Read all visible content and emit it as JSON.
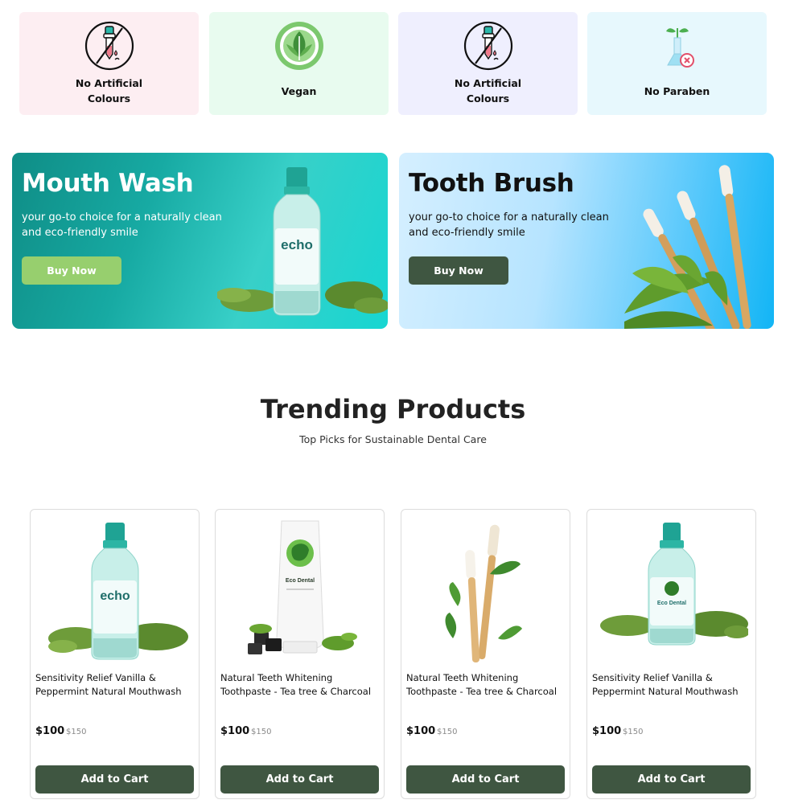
{
  "features": [
    {
      "label_line1": "No Artificial",
      "label_line2": "Colours",
      "icon": "no-dropper-icon",
      "bg": "#fdeef2"
    },
    {
      "label_line1": "Vegan",
      "label_line2": "",
      "icon": "vegan-leaf-icon",
      "bg": "#e8fbef"
    },
    {
      "label_line1": "No Artificial",
      "label_line2": "Colours",
      "icon": "no-dropper-icon",
      "bg": "#efeffe"
    },
    {
      "label_line1": "No Paraben",
      "label_line2": "",
      "icon": "no-paraben-flask-icon",
      "bg": "#e7f8fd"
    }
  ],
  "banners": {
    "mouthwash": {
      "title": "Mouth Wash",
      "text": "your go-to choice for a naturally clean and eco-friendly smile",
      "button": "Buy Now",
      "bottle_brand": "echo"
    },
    "toothbrush": {
      "title": "Tooth Brush",
      "text": "your go-to choice for a naturally clean and eco-friendly smile",
      "button": "Buy Now"
    }
  },
  "trending": {
    "title": "Trending Products",
    "subtitle": "Top Picks for Sustainable Dental Care"
  },
  "products": [
    {
      "name": "Sensitivity Relief Vanilla & Peppermint Natural Mouthwash",
      "price": "$100",
      "old_price": "$150",
      "button": "Add to Cart",
      "image": "mouthwash-bottle-image",
      "brand": "echo"
    },
    {
      "name": "Natural Teeth Whitening Toothpaste - Tea tree & Charcoal",
      "price": "$100",
      "old_price": "$150",
      "button": "Add to Cart",
      "image": "toothpaste-tube-image",
      "brand": "Eco Dental"
    },
    {
      "name": "Natural Teeth Whitening Toothpaste - Tea tree & Charcoal",
      "price": "$100",
      "old_price": "$150",
      "button": "Add to Cart",
      "image": "bamboo-toothbrush-image",
      "brand": ""
    },
    {
      "name": "Sensitivity Relief Vanilla & Peppermint Natural Mouthwash",
      "price": "$100",
      "old_price": "$150",
      "button": "Add to Cart",
      "image": "mouthwash-bottle-image",
      "brand": "Eco Dental"
    }
  ],
  "colors": {
    "dark_green": "#3f5641",
    "light_green": "#97cf6e",
    "teal": "#17aaa3",
    "sky": "#12b5f5"
  }
}
